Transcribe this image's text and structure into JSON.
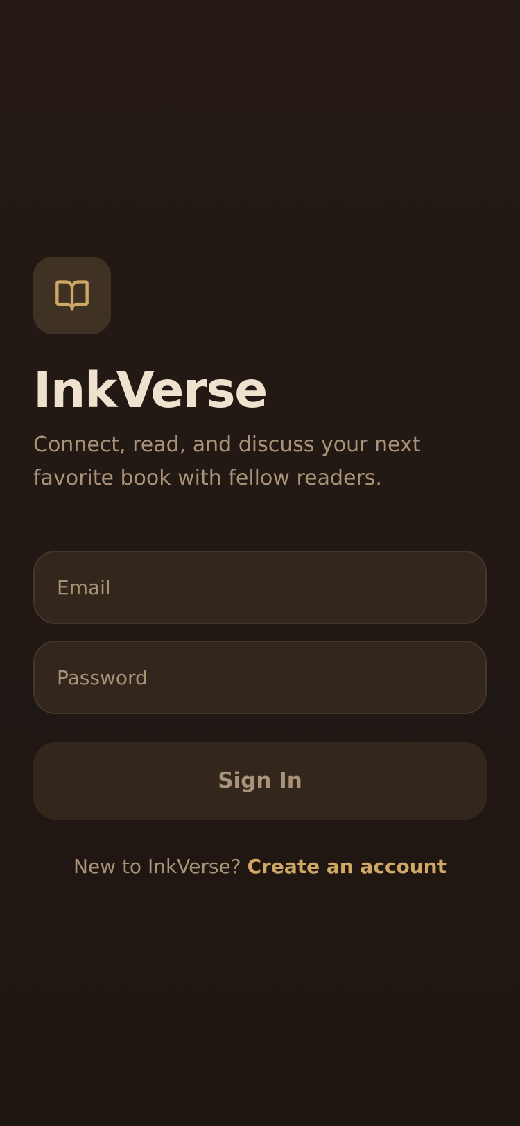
{
  "app": {
    "title": "InkVerse",
    "tagline": "Connect, read, and discuss your next favorite book with fellow readers.",
    "logo_icon": "open-book-icon"
  },
  "form": {
    "email_placeholder": "Email",
    "email_value": "",
    "password_placeholder": "Password",
    "password_value": "",
    "submit_label": "Sign In"
  },
  "signup": {
    "prompt": "New to InkVerse?",
    "link_label": "Create an account"
  },
  "colors": {
    "background": "#201712",
    "surface": "#33271d",
    "logo_tile": "#3f3124",
    "title_text": "#eee2cf",
    "muted_text": "#a99378",
    "accent": "#d0a866"
  }
}
